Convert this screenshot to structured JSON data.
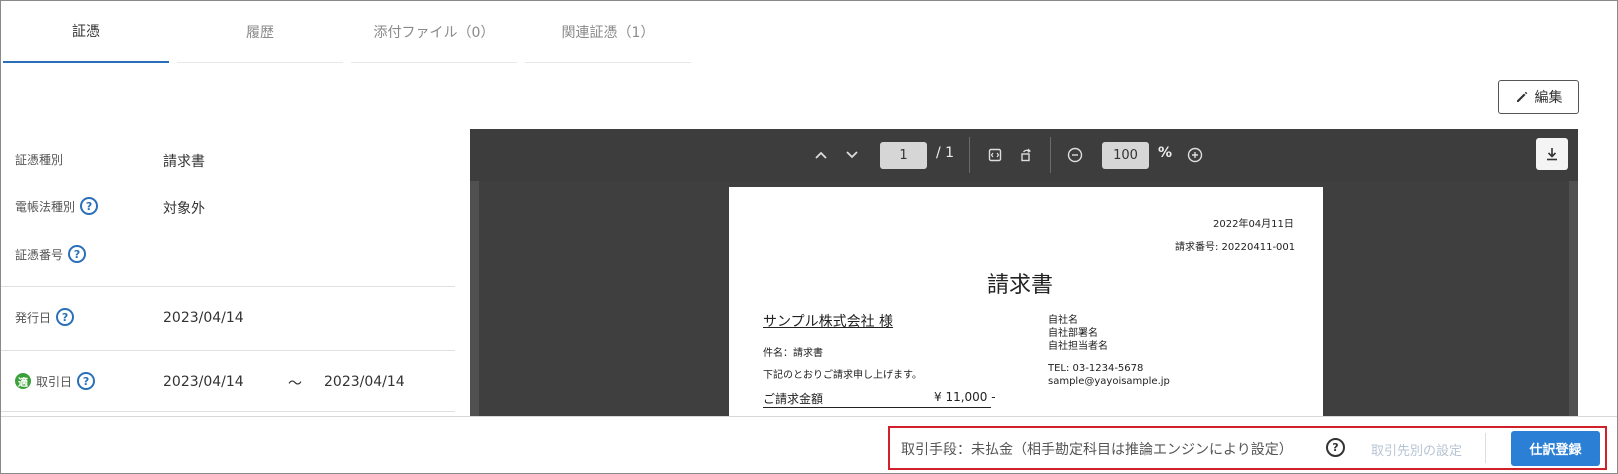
{
  "tabs": [
    {
      "label": "証憑"
    },
    {
      "label": "履歴"
    },
    {
      "label": "添付ファイル（0）"
    },
    {
      "label": "関連証憑（1）"
    }
  ],
  "edit_button": {
    "label": "編集"
  },
  "form": {
    "voucher_type": {
      "label": "証憑種別",
      "value": "請求書"
    },
    "ebook_law_type": {
      "label": "電帳法種別",
      "value": "対象外"
    },
    "voucher_number": {
      "label": "証憑番号",
      "value": ""
    },
    "issue_date": {
      "label": "発行日",
      "value": "2023/04/14"
    },
    "transaction_date": {
      "label": "取引日",
      "badge": "適",
      "from": "2023/04/14",
      "separator": "～",
      "to": "2023/04/14"
    }
  },
  "viewer": {
    "page_current": "1",
    "page_total": "/ 1",
    "zoom": "100",
    "zoom_unit": "%"
  },
  "document": {
    "date": "2022年04月11日",
    "invoice_no": "請求番号: 20220411-001",
    "title": "請求書",
    "recipient": "サンプル株式会社 様",
    "subject": "件名：請求書",
    "message": "下記のとおりご請求申し上げます。",
    "amount_label": "ご請求金額",
    "amount_value": "¥ 11,000 -",
    "company_name": "自社名",
    "department": "自社部署名",
    "contact_person": "自社担当者名",
    "tel": "TEL: 03-1234-5678",
    "email": "sample@yayoisample.jp"
  },
  "bottom": {
    "method_text": "取引手段：未払金（相手勘定科目は推論エンジンにより設定）",
    "partner_setting": "取引先別の設定",
    "register_button": "仕訳登録"
  },
  "colors": {
    "accent": "#2a70b9",
    "primary_button": "#2b7fd5",
    "highlight_border": "#d0212a",
    "badge_green": "#3aa13a"
  }
}
